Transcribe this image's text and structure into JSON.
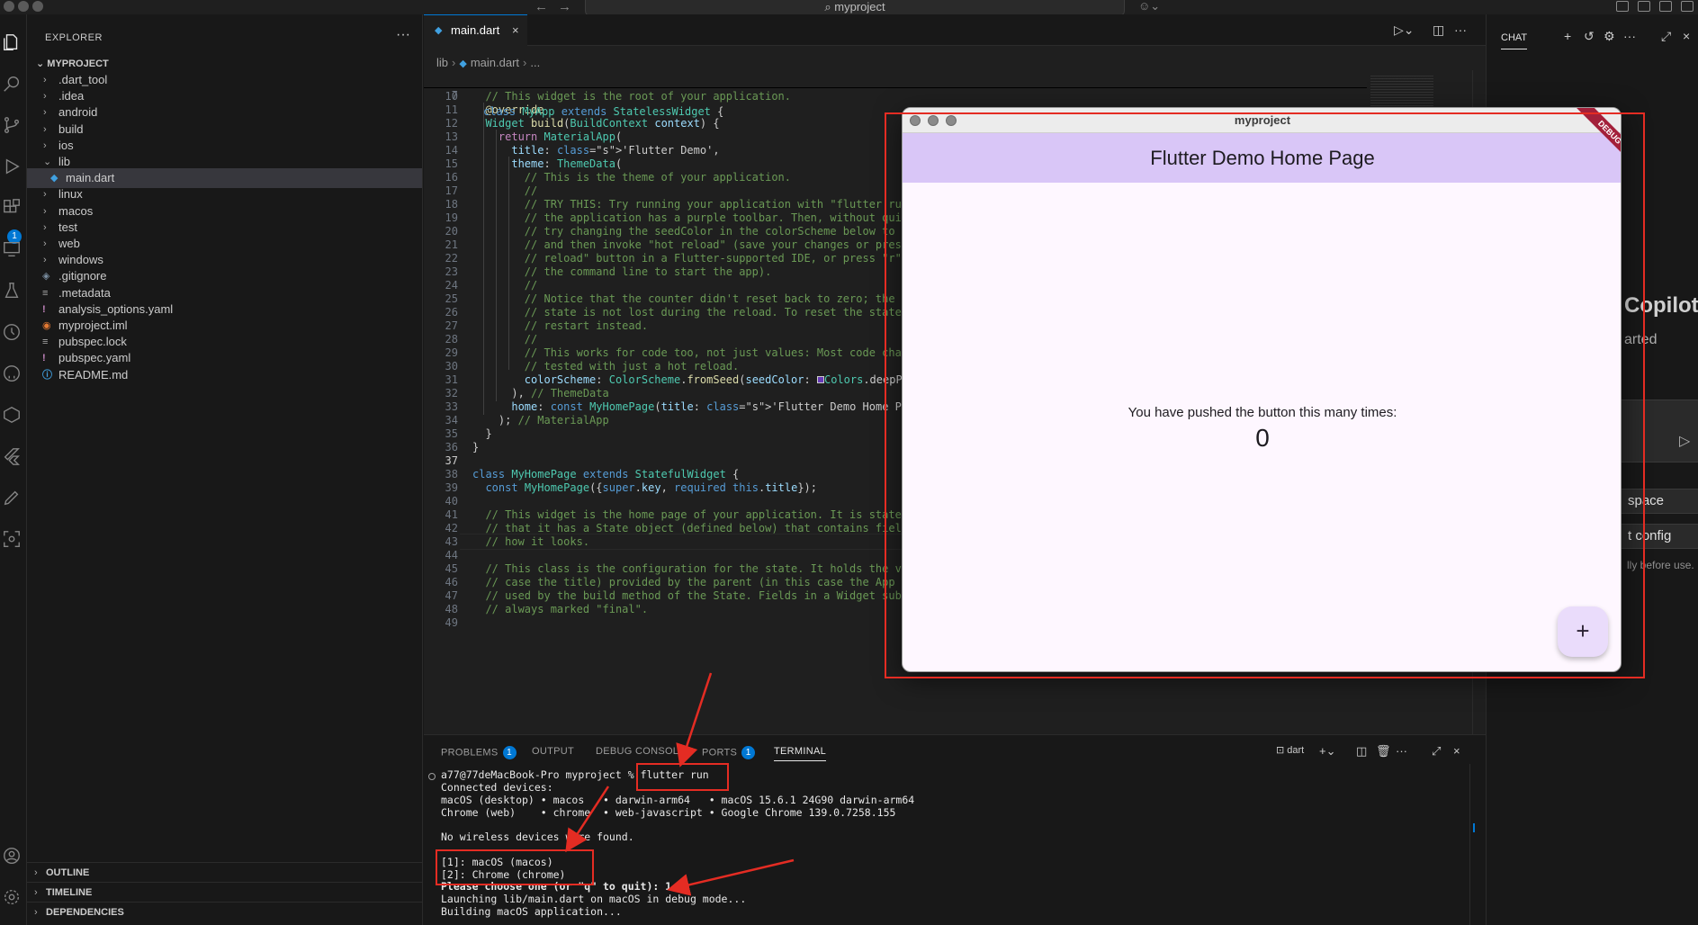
{
  "titlebar": {
    "search_text": "myproject"
  },
  "activity": {
    "badge": "1"
  },
  "sidebar": {
    "title": "EXPLORER",
    "more": "···",
    "project": "MYPROJECT",
    "tree": [
      {
        "label": ".dart_tool",
        "kind": "folder"
      },
      {
        "label": ".idea",
        "kind": "folder"
      },
      {
        "label": "android",
        "kind": "folder"
      },
      {
        "label": "build",
        "kind": "folder"
      },
      {
        "label": "ios",
        "kind": "folder"
      },
      {
        "label": "lib",
        "kind": "folder-open"
      },
      {
        "label": "main.dart",
        "kind": "dart"
      },
      {
        "label": "linux",
        "kind": "folder"
      },
      {
        "label": "macos",
        "kind": "folder"
      },
      {
        "label": "test",
        "kind": "folder"
      },
      {
        "label": "web",
        "kind": "folder"
      },
      {
        "label": "windows",
        "kind": "folder"
      },
      {
        "label": ".gitignore",
        "kind": "git"
      },
      {
        "label": ".metadata",
        "kind": "lines"
      },
      {
        "label": "analysis_options.yaml",
        "kind": "yaml"
      },
      {
        "label": "myproject.iml",
        "kind": "rss"
      },
      {
        "label": "pubspec.lock",
        "kind": "lines"
      },
      {
        "label": "pubspec.yaml",
        "kind": "yaml"
      },
      {
        "label": "README.md",
        "kind": "info"
      }
    ],
    "sections": [
      "OUTLINE",
      "TIMELINE",
      "DEPENDENCIES"
    ]
  },
  "editor": {
    "tab_label": "main.dart",
    "breadcrumb": [
      "lib",
      "main.dart",
      "..."
    ],
    "sticky_line": {
      "num": "7",
      "code": "class MyApp extends StatelessWidget {"
    },
    "lines": [
      {
        "num": "10",
        "code": "  // This widget is the root of your application."
      },
      {
        "num": "11",
        "code": "  @override"
      },
      {
        "num": "12",
        "code": "  Widget build(BuildContext context) {"
      },
      {
        "num": "13",
        "code": "    return MaterialApp("
      },
      {
        "num": "14",
        "code": "      title: 'Flutter Demo',"
      },
      {
        "num": "15",
        "code": "      theme: ThemeData("
      },
      {
        "num": "16",
        "code": "        // This is the theme of your application."
      },
      {
        "num": "17",
        "code": "        //"
      },
      {
        "num": "18",
        "code": "        // TRY THIS: Try running your application with \"flutter run\". You'll see"
      },
      {
        "num": "19",
        "code": "        // the application has a purple toolbar. Then, without quitting the app,"
      },
      {
        "num": "20",
        "code": "        // try changing the seedColor in the colorScheme below to Colors.green"
      },
      {
        "num": "21",
        "code": "        // and then invoke \"hot reload\" (save your changes or press the \"hot"
      },
      {
        "num": "22",
        "code": "        // reload\" button in a Flutter-supported IDE, or press \"r\" if you used"
      },
      {
        "num": "23",
        "code": "        // the command line to start the app)."
      },
      {
        "num": "24",
        "code": "        //"
      },
      {
        "num": "25",
        "code": "        // Notice that the counter didn't reset back to zero; the application"
      },
      {
        "num": "26",
        "code": "        // state is not lost during the reload. To reset the state, use hot"
      },
      {
        "num": "27",
        "code": "        // restart instead."
      },
      {
        "num": "28",
        "code": "        //"
      },
      {
        "num": "29",
        "code": "        // This works for code too, not just values: Most code changes can be"
      },
      {
        "num": "30",
        "code": "        // tested with just a hot reload."
      },
      {
        "num": "31",
        "code": "        colorScheme: ColorScheme.fromSeed(seedColor: ■Colors.deepPurple),"
      },
      {
        "num": "32",
        "code": "      ), // ThemeData"
      },
      {
        "num": "33",
        "code": "      home: const MyHomePage(title: 'Flutter Demo Home Page'),"
      },
      {
        "num": "34",
        "code": "    ); // MaterialApp"
      },
      {
        "num": "35",
        "code": "  }"
      },
      {
        "num": "36",
        "code": "}"
      },
      {
        "num": "37",
        "code": ""
      },
      {
        "num": "38",
        "code": "class MyHomePage extends StatefulWidget {"
      },
      {
        "num": "39",
        "code": "  const MyHomePage({super.key, required this.title});"
      },
      {
        "num": "40",
        "code": ""
      },
      {
        "num": "41",
        "code": "  // This widget is the home page of your application. It is stateful, meaning"
      },
      {
        "num": "42",
        "code": "  // that it has a State object (defined below) that contains fields that affect"
      },
      {
        "num": "43",
        "code": "  // how it looks."
      },
      {
        "num": "44",
        "code": ""
      },
      {
        "num": "45",
        "code": "  // This class is the configuration for the state. It holds the values (in this"
      },
      {
        "num": "46",
        "code": "  // case the title) provided by the parent (in this case the App widget) and"
      },
      {
        "num": "47",
        "code": "  // used by the build method of the State. Fields in a Widget subclass are"
      },
      {
        "num": "48",
        "code": "  // always marked \"final\"."
      },
      {
        "num": "49",
        "code": ""
      }
    ]
  },
  "chat": {
    "tab": "CHAT",
    "title": "Copilot",
    "subtitle": "arted",
    "pill1": "space",
    "pill2": "t config",
    "note": "lly before use."
  },
  "panel": {
    "tabs": [
      {
        "label": "PROBLEMS",
        "badge": "1"
      },
      {
        "label": "OUTPUT"
      },
      {
        "label": "DEBUG CONSOLE"
      },
      {
        "label": "PORTS",
        "badge": "1"
      },
      {
        "label": "TERMINAL"
      }
    ],
    "terminal_name": "dart",
    "prompt": "a77@77deMacBook-Pro myproject % ",
    "command": "flutter run",
    "lines": [
      "Connected devices:",
      "macOS (desktop) • macos   • darwin-arm64   • macOS 15.6.1 24G90 darwin-arm64",
      "Chrome (web)    • chrome  • web-javascript • Google Chrome 139.0.7258.155",
      "",
      "No wireless devices were found.",
      "",
      "[1]: macOS (macos)",
      "[2]: Chrome (chrome)",
      "Please choose one (or \"q\" to quit): 1",
      "Launching lib/main.dart on macOS in debug mode...",
      "Building macOS application..."
    ]
  },
  "flutter_app": {
    "window_title": "myproject",
    "appbar_title": "Flutter Demo Home Page",
    "debug_banner": "DEBUG",
    "message": "You have pushed the button this many times:",
    "counter": "0",
    "fab_label": "+"
  },
  "colors": {
    "accent": "#0078d4",
    "annotation": "#e42c23",
    "appbar": "#d9c6f7"
  }
}
